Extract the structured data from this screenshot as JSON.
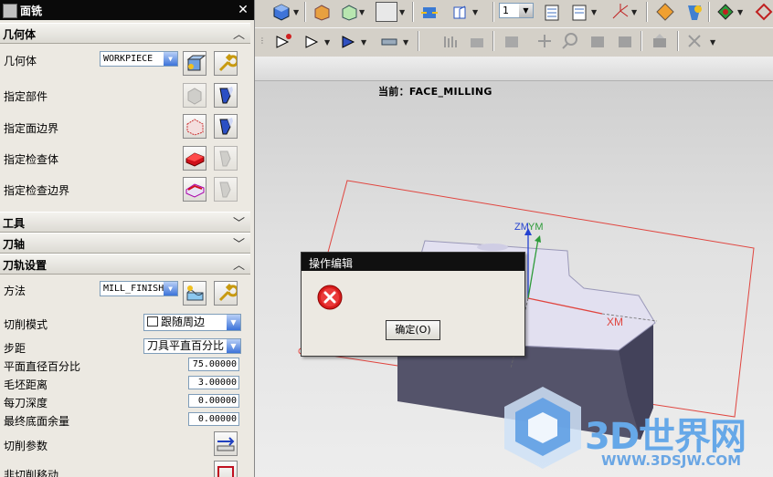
{
  "panel": {
    "title": "面铣",
    "close_symbol": "✕",
    "sections": {
      "geometry": {
        "label": "几何体",
        "state": "expanded"
      },
      "tool": {
        "label": "工具",
        "state": "collapsed"
      },
      "tool_axis": {
        "label": "刀轴",
        "state": "collapsed"
      },
      "path_settings": {
        "label": "刀轨设置",
        "state": "expanded"
      }
    },
    "geometry_rows": {
      "geometry": {
        "label": "几何体",
        "value": "WORKPIECE"
      },
      "specify_part": "指定部件",
      "specify_face_boundary": "指定面边界",
      "specify_check_body": "指定检查体",
      "specify_check_boundary": "指定检查边界"
    },
    "path_rows": {
      "method": {
        "label": "方法",
        "value": "MILL_FINISH"
      },
      "cut_pattern": {
        "label": "切削模式",
        "value": "跟随周边"
      },
      "stepover": {
        "label": "步距",
        "value": "刀具平直百分比"
      },
      "flat_diameter_percent": {
        "label": "平面直径百分比",
        "value": "75.00000"
      },
      "blank_distance": {
        "label": "毛坯距离",
        "value": "3.00000"
      },
      "depth_per_cut": {
        "label": "每刀深度",
        "value": "0.00000"
      },
      "final_floor_stock": {
        "label": "最终底面余量",
        "value": "0.00000"
      },
      "cutting_params": "切削参数",
      "non_cutting_moves": "非切削移动"
    }
  },
  "toolbar": {
    "layer_value": "1"
  },
  "viewport": {
    "current_label": "当前：FACE_MILLING",
    "axis_labels": {
      "zm": "ZM",
      "ym": "YM",
      "xm": "XM"
    }
  },
  "dialog": {
    "title": "操作编辑",
    "ok_label": "确定(O)"
  },
  "watermark": {
    "brand": "3D世界网",
    "url": "WWW.3DSJW.COM"
  },
  "colors": {
    "titlebar": "#0a0a0a",
    "boundary_red": "#e0453f",
    "part_face": "#e2e0f0",
    "part_side": "#54536a",
    "axis_green": "#2e9b3a",
    "axis_blue": "#2442d0",
    "watermark_blue": "#66a8e8"
  },
  "icons": [
    "cube-icon",
    "wrench-icon",
    "flashlight-icon",
    "error-icon",
    "fit-view-icon"
  ]
}
